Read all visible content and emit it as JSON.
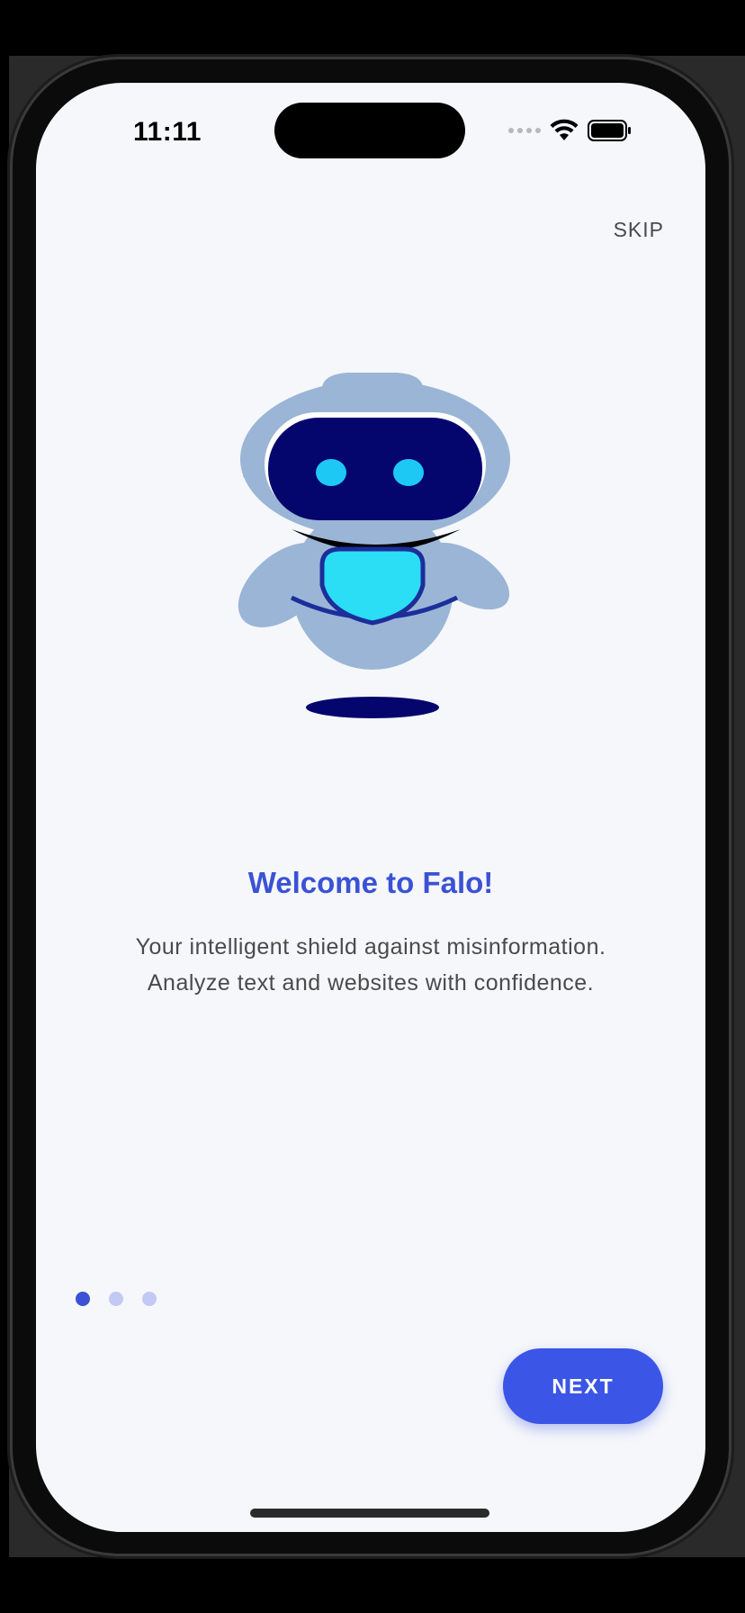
{
  "status_bar": {
    "time": "11:11"
  },
  "onboarding": {
    "skip_label": "SKIP",
    "title": "Welcome to Falo!",
    "subtitle_line1": "Your intelligent shield against misinformation.",
    "subtitle_line2": "Analyze text and websites with confidence.",
    "next_label": "NEXT",
    "page_count": 3,
    "current_page": 1
  },
  "colors": {
    "accent": "#3b52d4",
    "button": "#3b55e6",
    "background": "#f5f7fa",
    "robot_body": "#9bb5d6",
    "robot_visor": "#05056e",
    "robot_eye": "#1ec8f5"
  },
  "icons": {
    "signal": "cellular-signal-icon",
    "wifi": "wifi-icon",
    "battery": "battery-icon",
    "mascot": "robot-mascot-illustration"
  }
}
